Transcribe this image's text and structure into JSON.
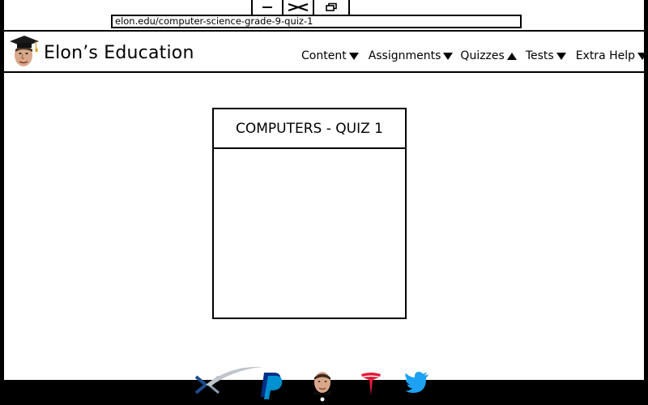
{
  "browser": {
    "url": "elon.edu/computer-science-grade-9-quiz-1",
    "controls": [
      "minimize",
      "close",
      "restore"
    ]
  },
  "header": {
    "site_title": "Elon’s Education",
    "logo_icon": "graduate-face-logo-icon",
    "nav": [
      {
        "label": "Content",
        "arrow": "down"
      },
      {
        "label": "Assignments",
        "arrow": "down"
      },
      {
        "label": "Quizzes",
        "arrow": "up"
      },
      {
        "label": "Tests",
        "arrow": "down"
      },
      {
        "label": "Extra Help",
        "arrow": "down"
      }
    ]
  },
  "main": {
    "quiz_title": "COMPUTERS - QUIZ 1"
  },
  "footer": {
    "icons": [
      "spacex-icon",
      "paypal-icon",
      "elon-face-icon",
      "tesla-icon",
      "twitter-icon"
    ]
  },
  "colors": {
    "page_bg": "#ffffff",
    "frame": "#000000",
    "paypal_dark": "#003087",
    "paypal_light": "#009cde",
    "tesla_red": "#e31937",
    "twitter_blue": "#1da1f2",
    "spacex_blue": "#1c4d8c"
  }
}
